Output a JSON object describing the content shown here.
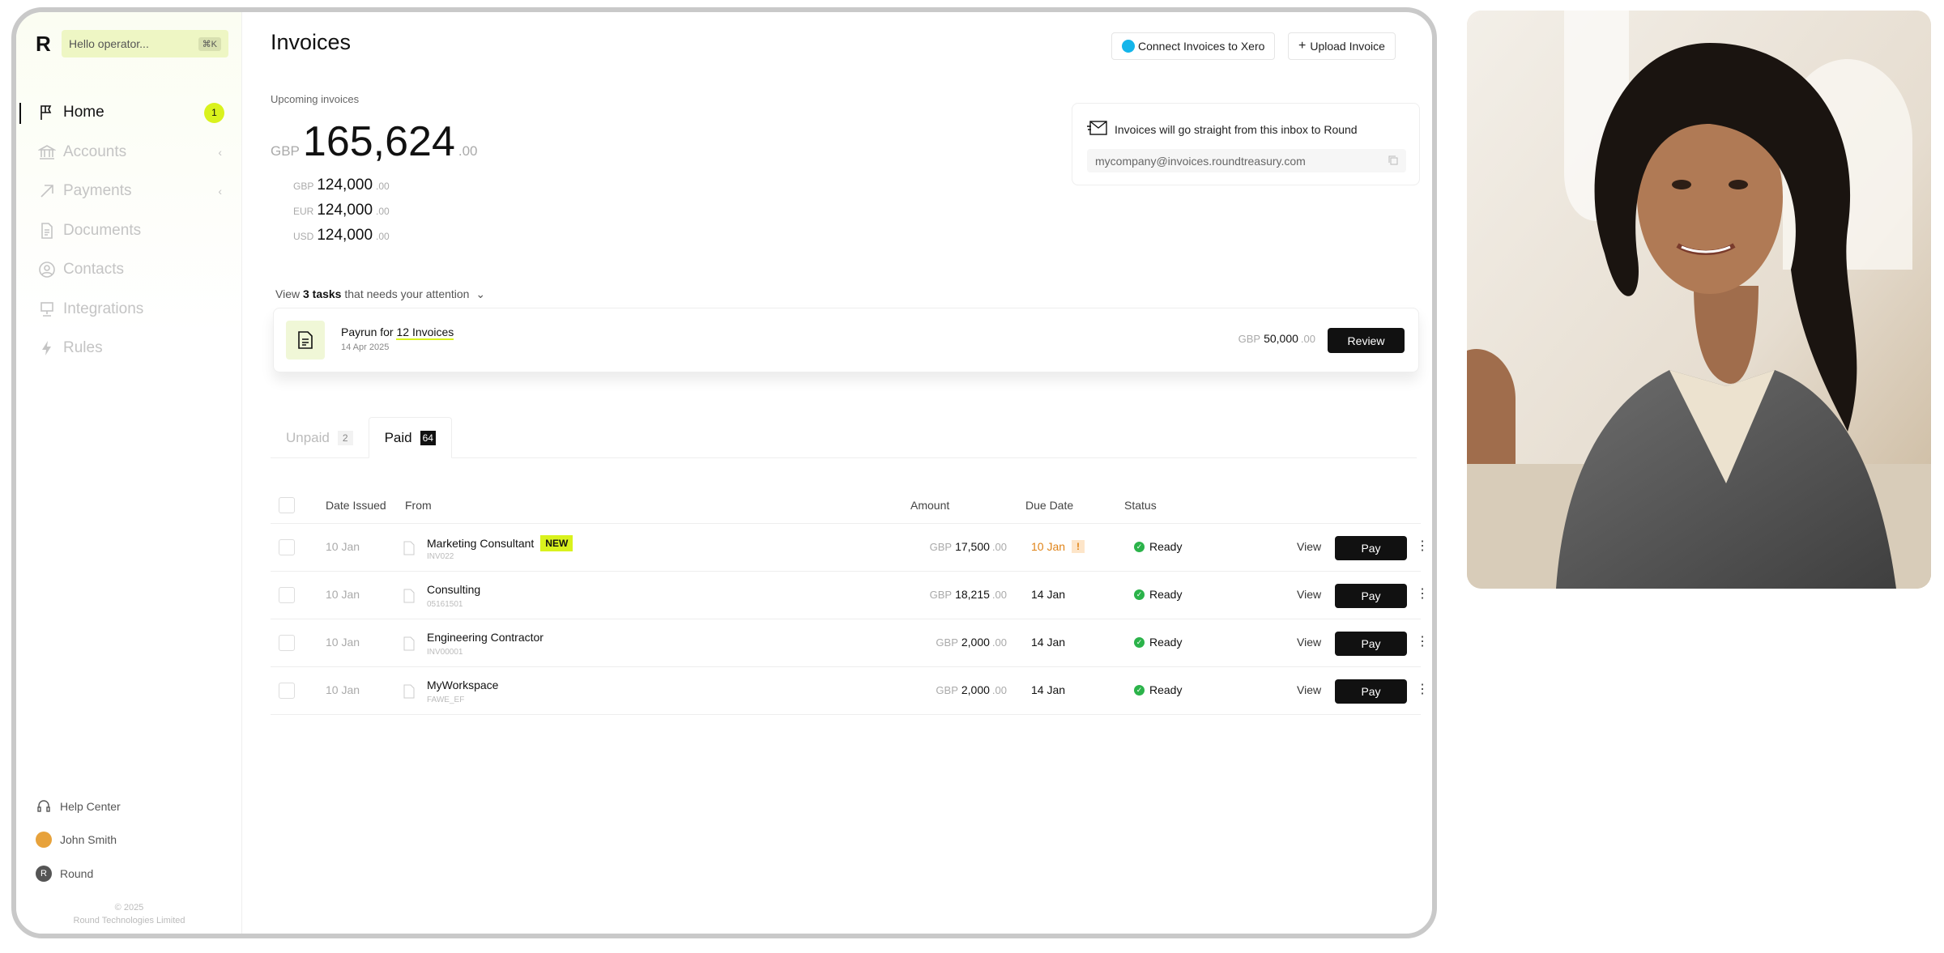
{
  "sidebar": {
    "logo": "R",
    "search_placeholder": "Hello operator...",
    "search_shortcut": "⌘K",
    "nav": [
      {
        "label": "Home",
        "icon": "flag-icon",
        "badge": "1",
        "active": true
      },
      {
        "label": "Accounts",
        "icon": "bank-icon",
        "chevron": "‹"
      },
      {
        "label": "Payments",
        "icon": "arrow-up-right-icon",
        "chevron": "‹"
      },
      {
        "label": "Documents",
        "icon": "document-icon"
      },
      {
        "label": "Contacts",
        "icon": "user-circle-icon"
      },
      {
        "label": "Integrations",
        "icon": "monitor-icon"
      },
      {
        "label": "Rules",
        "icon": "lightning-icon"
      }
    ],
    "bottom": [
      {
        "label": "Help Center",
        "icon": "headset-icon"
      },
      {
        "label": "John Smith",
        "icon": "avatar"
      },
      {
        "label": "Round",
        "icon": "R"
      }
    ],
    "copyright_year": "© 2025",
    "copyright_company": "Round Technologies Limited"
  },
  "header": {
    "title": "Invoices",
    "connect_label": "Connect Invoices to Xero",
    "upload_label": "Upload Invoice",
    "upload_icon": "+"
  },
  "upcoming": {
    "label": "Upcoming invoices",
    "currency": "GBP",
    "amount": "165,624",
    "decimals": ".00",
    "breakdown": [
      {
        "currency": "GBP",
        "amount": "124,000",
        "decimals": ".00"
      },
      {
        "currency": "EUR",
        "amount": "124,000",
        "decimals": ".00"
      },
      {
        "currency": "USD",
        "amount": "124,000",
        "decimals": ".00"
      }
    ]
  },
  "inbox": {
    "text": "Invoices will go straight from this inbox to Round",
    "email": "mycompany@invoices.roundtreasury.com"
  },
  "tasks": {
    "prefix": "View",
    "count": "3 tasks",
    "suffix": "that needs your attention",
    "chevron": "⌄",
    "card": {
      "title_prefix": "Payrun for",
      "title_link": "12 Invoices",
      "date": "14 Apr 2025",
      "currency": "GBP",
      "amount": "50,000",
      "decimals": ".00",
      "review_label": "Review"
    }
  },
  "tabs": [
    {
      "label": "Unpaid",
      "count": "2"
    },
    {
      "label": "Paid",
      "count": "64"
    }
  ],
  "table": {
    "headers": [
      "Date Issued",
      "From",
      "Amount",
      "Due Date",
      "Status"
    ],
    "rows": [
      {
        "date": "10 Jan",
        "from": "Marketing Consultant",
        "badge": "NEW",
        "ref": "INV022",
        "currency": "GBP",
        "amount": "17,500",
        "decimals": ".00",
        "due": "10 Jan",
        "due_warn": "!",
        "status": "Ready",
        "view": "View",
        "pay": "Pay"
      },
      {
        "date": "10 Jan",
        "from": "Consulting",
        "ref": "05161501",
        "currency": "GBP",
        "amount": "18,215",
        "decimals": ".00",
        "due": "14 Jan",
        "status": "Ready",
        "view": "View",
        "pay": "Pay"
      },
      {
        "date": "10 Jan",
        "from": "Engineering Contractor",
        "ref": "INV00001",
        "currency": "GBP",
        "amount": "2,000",
        "decimals": ".00",
        "due": "14 Jan",
        "status": "Ready",
        "view": "View",
        "pay": "Pay"
      },
      {
        "date": "10 Jan",
        "from": "MyWorkspace",
        "ref": "FAWE_EF",
        "currency": "GBP",
        "amount": "2,000",
        "decimals": ".00",
        "due": "14 Jan",
        "status": "Ready",
        "view": "View",
        "pay": "Pay"
      }
    ]
  },
  "colors": {
    "accent": "#d9f21d",
    "ready": "#2bb34a",
    "late": "#e08317",
    "xero": "#13b5ea"
  }
}
